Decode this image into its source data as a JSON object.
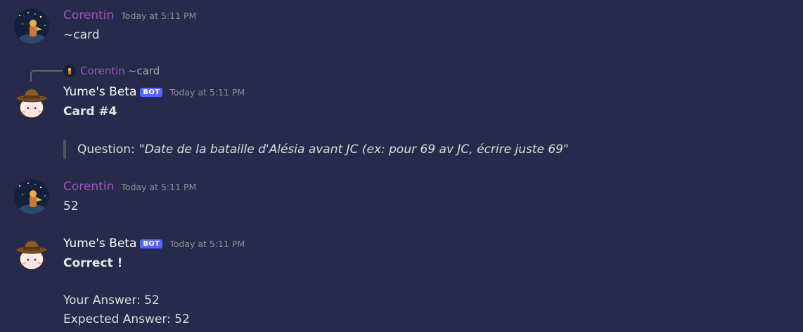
{
  "messages": [
    {
      "author": "Corentin",
      "timestamp": "Today at 5:11 PM",
      "text": "~card"
    },
    {
      "reply": {
        "author": "Corentin",
        "text": "~card"
      },
      "author": "Yume's Beta",
      "badge": "BOT",
      "timestamp": "Today at 5:11 PM",
      "title": "Card #4",
      "quote_label": "Question:",
      "quote_text": "\"Date de la bataille d'Alésia avant JC (ex: pour 69 av JC, écrire juste 69\""
    },
    {
      "author": "Corentin",
      "timestamp": "Today at 5:11 PM",
      "text": "52"
    },
    {
      "author": "Yume's Beta",
      "badge": "BOT",
      "timestamp": "Today at 5:11 PM",
      "title": "Correct !",
      "lines": [
        "Your Answer: 52",
        "Expected Answer: 52"
      ]
    }
  ],
  "colors": {
    "background": "#272a4a",
    "corentin_name": "#9b59b6",
    "bot_badge": "#5865f2"
  },
  "icons": [
    "corentin-avatar",
    "yume-sheep-cowboy-avatar"
  ]
}
